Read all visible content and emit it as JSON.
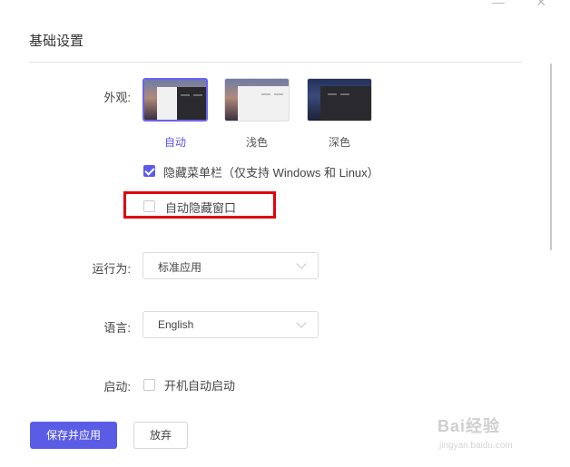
{
  "window": {
    "minimize_glyph": "—",
    "close_glyph": "✕"
  },
  "section": {
    "title": "基础设置"
  },
  "appearance": {
    "label": "外观:",
    "options": [
      {
        "label": "自动",
        "selected": true
      },
      {
        "label": "浅色",
        "selected": false
      },
      {
        "label": "深色",
        "selected": false
      }
    ],
    "accent": "#5c55e6"
  },
  "options": {
    "hide_menubar": {
      "label": "隐藏菜单栏（仅支持 Windows 和 Linux）",
      "checked": true
    },
    "auto_hide_window": {
      "label": "自动隐藏窗口",
      "checked": false
    }
  },
  "run_as": {
    "label": "运行为:",
    "value": "标准应用"
  },
  "language": {
    "label": "语言:",
    "value": "English"
  },
  "startup": {
    "label": "启动:",
    "checkbox_label": "开机自动启动",
    "checked": false
  },
  "actions": {
    "save_apply": "保存并应用",
    "discard": "放弃"
  },
  "watermark": {
    "main": "Bai经验",
    "sub": "jingyan.baidu.com"
  },
  "colors": {
    "primary": "#5a5ce6",
    "highlight": "#e0000f"
  }
}
